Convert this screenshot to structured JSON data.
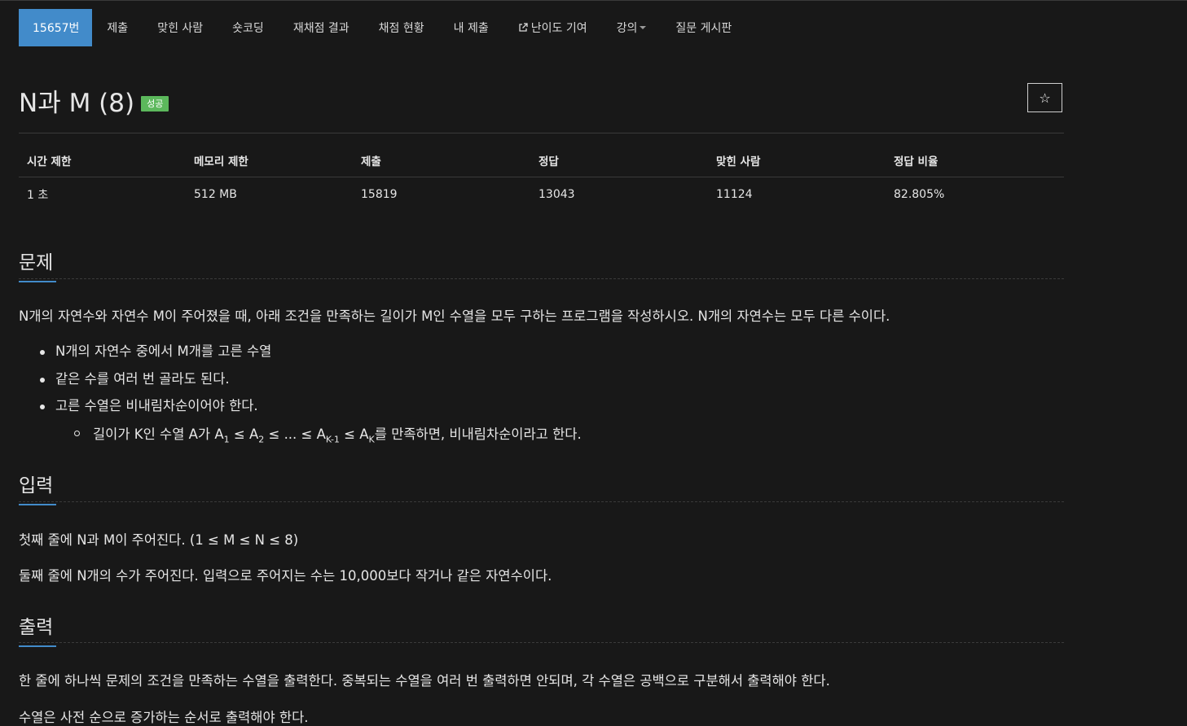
{
  "nav": {
    "items": [
      {
        "label": "15657번",
        "active": true
      },
      {
        "label": "제출"
      },
      {
        "label": "맞힌 사람"
      },
      {
        "label": "숏코딩"
      },
      {
        "label": "재채점 결과"
      },
      {
        "label": "채점 현황"
      },
      {
        "label": "내 제출"
      },
      {
        "label": "난이도 기여",
        "icon": "external-link-icon"
      },
      {
        "label": "강의",
        "icon": "caret-down-icon"
      },
      {
        "label": "질문 게시판"
      }
    ]
  },
  "problem": {
    "title": "N과 M (8)",
    "badge": "성공",
    "star_icon": "☆"
  },
  "info": {
    "headers": [
      "시간 제한",
      "메모리 제한",
      "제출",
      "정답",
      "맞힌 사람",
      "정답 비율"
    ],
    "values": [
      "1 초",
      "512 MB",
      "15819",
      "13043",
      "11124",
      "82.805%"
    ]
  },
  "sections": {
    "problem_heading": "문제",
    "problem_text": "N개의 자연수와 자연수 M이 주어졌을 때, 아래 조건을 만족하는 길이가 M인 수열을 모두 구하는 프로그램을 작성하시오. N개의 자연수는 모두 다른 수이다.",
    "bullets": [
      "N개의 자연수 중에서 M개를 고른 수열",
      "같은 수를 여러 번 골라도 된다.",
      "고른 수열은 비내림차순이어야 한다."
    ],
    "sub_bullet": {
      "prefix": "길이가 K인 수열 A가 A",
      "s1": "1",
      "mid1": " ≤ A",
      "s2": "2",
      "mid2": " ≤ ... ≤ A",
      "s3": "K-1",
      "mid3": " ≤ A",
      "s4": "K",
      "suffix": "를 만족하면, 비내림차순이라고 한다."
    },
    "input_heading": "입력",
    "input_lines": [
      "첫째 줄에 N과 M이 주어진다. (1 ≤ M ≤ N ≤ 8)",
      "둘째 줄에 N개의 수가 주어진다. 입력으로 주어지는 수는 10,000보다 작거나 같은 자연수이다."
    ],
    "output_heading": "출력",
    "output_lines": [
      "한 줄에 하나씩 문제의 조건을 만족하는 수열을 출력한다. 중복되는 수열을 여러 번 출력하면 안되며, 각 수열은 공백으로 구분해서 출력해야 한다.",
      "수열은 사전 순으로 증가하는 순서로 출력해야 한다."
    ]
  },
  "colors": {
    "accent": "#428bca",
    "success": "#5cb85c",
    "background": "#181818"
  }
}
